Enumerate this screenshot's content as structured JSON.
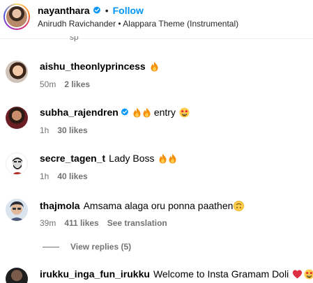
{
  "header": {
    "username": "nayanthara",
    "separator": "•",
    "follow_label": "Follow",
    "audio": "Anirudh Ravichander • Alappara Theme (Instrumental)"
  },
  "peek_text": "sp",
  "comments": [
    {
      "user": "aishu_theonlyprincess",
      "text": "",
      "emoji": [
        "fire"
      ],
      "time": "50m",
      "likes": "2 likes"
    },
    {
      "user": "subha_rajendren",
      "verified": true,
      "text": "entry",
      "emoji": [
        "fire",
        "fire",
        "star-struck"
      ],
      "time": "1h",
      "likes": "30 likes"
    },
    {
      "user": "secre_tagen_t",
      "text": "Lady Boss",
      "emoji": [
        "fire",
        "fire"
      ],
      "time": "1h",
      "likes": "40 likes"
    },
    {
      "user": "thajmola",
      "text": "Amsama alaga oru ponna paathen",
      "emoji": [
        "upside-down-face"
      ],
      "time": "39m",
      "likes": "411 likes",
      "see_translation": "See translation"
    },
    {
      "user": "irukku_inga_fun_irukku",
      "text": "Welcome to Insta Gramam Doli",
      "emoji": [
        "red-heart",
        "star-struck"
      ]
    }
  ],
  "view_replies": "View replies (5)",
  "colors": {
    "link_blue": "#0095f6",
    "muted_text": "#737373",
    "verified_blue": "#0095f6",
    "heart_red": "#e0245e"
  }
}
